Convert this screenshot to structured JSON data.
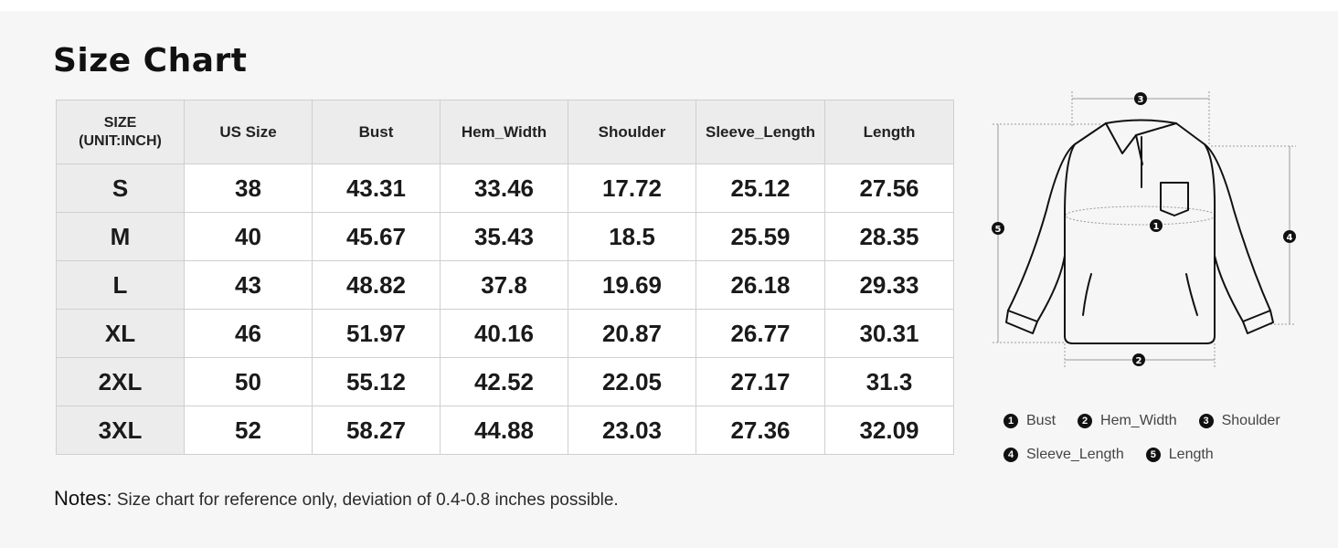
{
  "title": "Size Chart",
  "table": {
    "headers": [
      "SIZE\n(UNIT:INCH)",
      "US Size",
      "Bust",
      "Hem_Width",
      "Shoulder",
      "Sleeve_Length",
      "Length"
    ],
    "header_lines": [
      "SIZE",
      "(UNIT:INCH)"
    ],
    "rows": [
      [
        "S",
        "38",
        "43.31",
        "33.46",
        "17.72",
        "25.12",
        "27.56"
      ],
      [
        "M",
        "40",
        "45.67",
        "35.43",
        "18.5",
        "25.59",
        "28.35"
      ],
      [
        "L",
        "43",
        "48.82",
        "37.8",
        "19.69",
        "26.18",
        "29.33"
      ],
      [
        "XL",
        "46",
        "51.97",
        "40.16",
        "20.87",
        "26.77",
        "30.31"
      ],
      [
        "2XL",
        "50",
        "55.12",
        "42.52",
        "22.05",
        "27.17",
        "31.3"
      ],
      [
        "3XL",
        "52",
        "58.27",
        "44.88",
        "23.03",
        "27.36",
        "32.09"
      ]
    ]
  },
  "notes": {
    "label": "Notes:",
    "text": "Size chart for reference only, deviation of 0.4-0.8 inches possible."
  },
  "legend": [
    {
      "num": "1",
      "label": "Bust"
    },
    {
      "num": "2",
      "label": "Hem_Width"
    },
    {
      "num": "3",
      "label": "Shoulder"
    },
    {
      "num": "4",
      "label": "Sleeve_Length"
    },
    {
      "num": "5",
      "label": "Length"
    }
  ],
  "diagram_icon": "sweatshirt-measurement-diagram",
  "colors": {
    "panel": "#f6f6f6",
    "header": "#ececec",
    "border": "#cfcfcf",
    "text": "#1a1a1a"
  }
}
